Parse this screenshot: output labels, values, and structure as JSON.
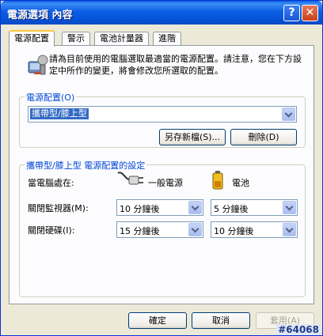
{
  "window": {
    "title": "電源選項 內容",
    "help_label": "?",
    "close_label": "✕"
  },
  "tabs": [
    {
      "label": "電源配置",
      "active": true
    },
    {
      "label": "警示",
      "active": false
    },
    {
      "label": "電池計量器",
      "active": false
    },
    {
      "label": "進階",
      "active": false
    }
  ],
  "description": "請為目前使用的電腦選取最適當的電源配置。請注意，您在下方設定中所作的變更，將會修改您所選取的配置。",
  "scheme_group": {
    "label": "電源配置(O)",
    "selected": "攜帶型/膝上型",
    "save_as_label": "另存新檔(S)...",
    "delete_label": "刪除(D)"
  },
  "settings_group": {
    "label": "攜帶型/膝上型 電源配置的設定",
    "when_label": "當電腦處在:",
    "ac_label": "一般電源",
    "battery_label": "電池",
    "rows": [
      {
        "label": "關閉監視器(M):",
        "ac_value": "10 分鐘後",
        "battery_value": "5 分鐘後"
      },
      {
        "label": "關閉硬碟(I):",
        "ac_value": "15 分鐘後",
        "battery_value": "10 分鐘後"
      }
    ]
  },
  "footer": {
    "ok_label": "確定",
    "cancel_label": "取消",
    "apply_label": "套用(A)"
  },
  "watermark": "#64068"
}
